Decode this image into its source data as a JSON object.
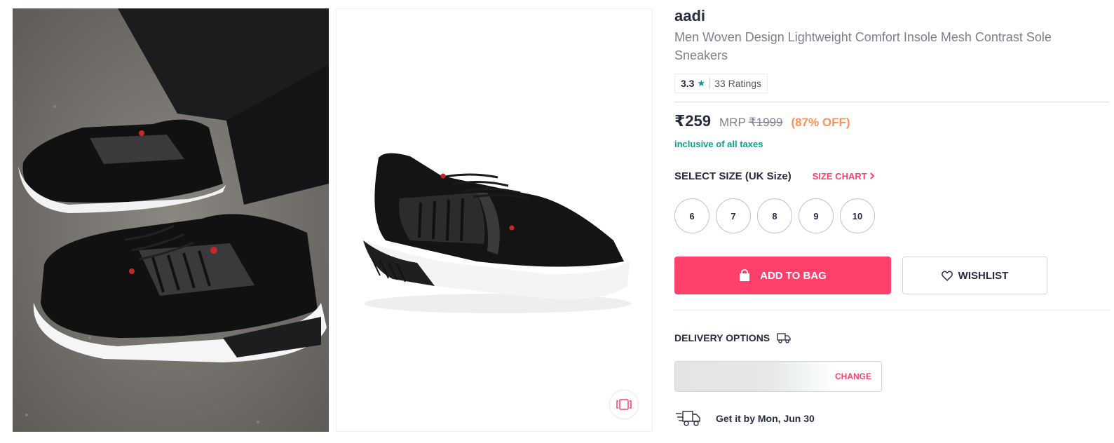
{
  "product": {
    "brand": "aadi",
    "name": "Men Woven Design Lightweight Comfort Insole Mesh Contrast Sole Sneakers"
  },
  "rating": {
    "value": "3.3",
    "star": "★",
    "count": "33 Ratings",
    "star_color": "#14958f"
  },
  "price": {
    "current": "₹259",
    "mrp_label": "MRP",
    "mrp_value": "₹1999",
    "discount": "(87% OFF)",
    "taxes_note": "inclusive of all taxes",
    "discount_color": "#ff905a"
  },
  "size": {
    "label": "SELECT SIZE (UK Size)",
    "chart_label": "SIZE CHART",
    "options": [
      "6",
      "7",
      "8",
      "9",
      "10"
    ]
  },
  "actions": {
    "add_to_bag": "ADD TO BAG",
    "wishlist": "WISHLIST",
    "accent_color": "#ff3f6c"
  },
  "delivery": {
    "label": "DELIVERY OPTIONS",
    "change_label": "CHANGE",
    "eta": "Get it by Mon, Jun 30"
  },
  "icons": {
    "rating": "star-icon",
    "size_chart": "chevron-right-icon",
    "bag": "bag-icon",
    "wishlist": "heart-icon",
    "delivery": "truck-icon",
    "eta": "fast-truck-icon",
    "similar": "similar-products-icon"
  }
}
